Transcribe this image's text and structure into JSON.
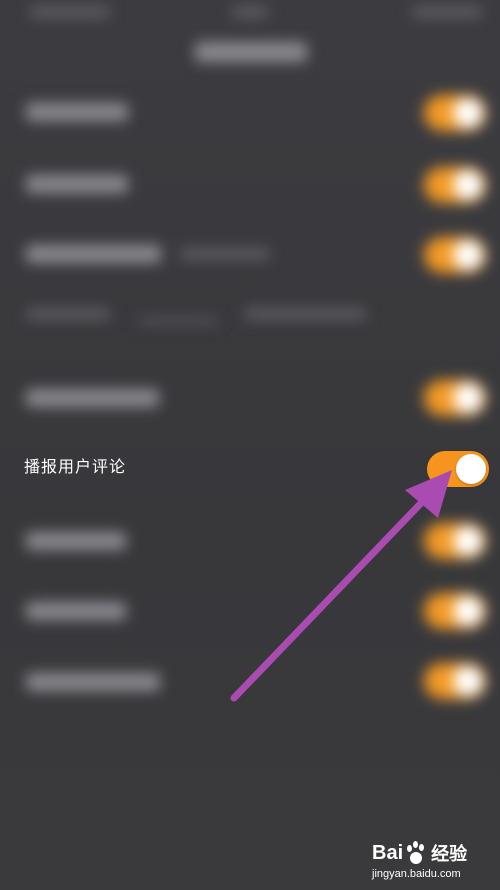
{
  "setting_row": {
    "label": "播报用户评论",
    "toggle_state": "on"
  },
  "watermark": {
    "brand_a": "Bai",
    "brand_b": "经验",
    "url": "jingyan.baidu.com"
  },
  "colors": {
    "background": "#3a3a3d",
    "toggle_on": "#f7941d",
    "arrow": "#a94bb0",
    "text": "#ffffff"
  },
  "icons": [
    "arrow-annotation-icon",
    "baidu-paw-icon"
  ]
}
